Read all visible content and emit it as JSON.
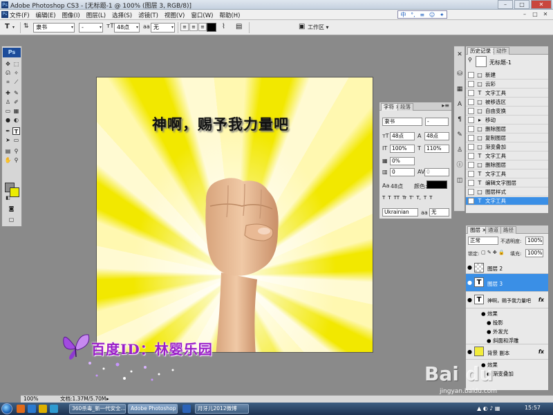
{
  "titlebar": {
    "title": "Adobe Photoshop CS3 - [无标题-1 @ 100% (图层 3, RGB/8)]",
    "minimize": "–",
    "maximize": "□",
    "close": "✕"
  },
  "menubar": {
    "items": [
      "文件(F)",
      "编辑(E)",
      "图像(I)",
      "图层(L)",
      "选择(S)",
      "滤镜(T)",
      "视图(V)",
      "窗口(W)",
      "帮助(H)"
    ],
    "ime": [
      "中",
      "°,",
      "≡",
      "☺",
      "✦"
    ]
  },
  "options": {
    "tool_glyph": "T",
    "font_family": "隶书",
    "font_style": "-",
    "font_size": "48点",
    "antialias": "无",
    "workspace": "工作区",
    "text_color": "#000000"
  },
  "tools": {
    "header": "Ps",
    "icons": [
      "move-tool",
      "marquee-tool",
      "lasso-tool",
      "magic-wand-tool",
      "crop-tool",
      "slice-tool",
      "heal-tool",
      "brush-tool",
      "stamp-tool",
      "history-brush-tool",
      "eraser-tool",
      "gradient-tool",
      "blur-tool",
      "dodge-tool",
      "pen-tool",
      "type-tool",
      "path-select-tool",
      "shape-tool",
      "notes-tool",
      "eyedropper-tool",
      "hand-tool",
      "zoom-tool"
    ],
    "fg_color": "#8d8d8d",
    "bg_color": "#ecec00"
  },
  "canvas": {
    "caption": "神啊，赐予我力量吧"
  },
  "watermark": {
    "text": "百度ID：林婴乐园"
  },
  "char_panel": {
    "tabs": [
      "字符",
      "段落"
    ],
    "font": "隶书",
    "style": "-",
    "size": "48点",
    "leading": "48点",
    "vscale": "100%",
    "hscale": "110%",
    "tracking_pct": "0%",
    "tracking": "0",
    "kerning": "0",
    "baseline": "48点",
    "color_label": "颜色:",
    "language": "Ukrainian",
    "aa": "无",
    "styles": [
      "T",
      "T",
      "TT",
      "Tr",
      "T'",
      "T,",
      "T",
      "T"
    ]
  },
  "history": {
    "tabs": [
      "历史记录",
      "动作"
    ],
    "snapshot": "无标题-1",
    "items": [
      {
        "icon": "□",
        "label": "新建"
      },
      {
        "icon": "□",
        "label": "云彩"
      },
      {
        "icon": "T",
        "label": "文字工具"
      },
      {
        "icon": "□",
        "label": "被移选区"
      },
      {
        "icon": "□",
        "label": "自由变换"
      },
      {
        "icon": "▸",
        "label": "移动"
      },
      {
        "icon": "□",
        "label": "删除图层"
      },
      {
        "icon": "□",
        "label": "复制图层"
      },
      {
        "icon": "□",
        "label": "渐变叠加"
      },
      {
        "icon": "T",
        "label": "文字工具"
      },
      {
        "icon": "□",
        "label": "删除图层"
      },
      {
        "icon": "T",
        "label": "文字工具"
      },
      {
        "icon": "T",
        "label": "编辑文字图层"
      },
      {
        "icon": "□",
        "label": "图层样式"
      },
      {
        "icon": "T",
        "label": "文字工具"
      }
    ]
  },
  "layers": {
    "tabs": [
      "图层",
      "通道",
      "路径"
    ],
    "blend_mode": "正常",
    "opacity_label": "不透明度:",
    "opacity": "100%",
    "lock_label": "锁定:",
    "fill_label": "填充:",
    "fill": "100%",
    "rows": [
      {
        "type": "image",
        "name": "图层 2",
        "fx": ""
      },
      {
        "type": "text",
        "name": "图层 3",
        "fx": ""
      },
      {
        "type": "text",
        "name": "神啊，赐予我力量吧",
        "fx": "fx"
      },
      {
        "type": "effect",
        "name": "效果",
        "fx": ""
      },
      {
        "type": "effect",
        "name": "投影",
        "fx": ""
      },
      {
        "type": "effect",
        "name": "外发光",
        "fx": ""
      },
      {
        "type": "effect",
        "name": "斜面和浮雕",
        "fx": ""
      },
      {
        "type": "image",
        "name": "背景 副本",
        "fx": "fx"
      },
      {
        "type": "effect",
        "name": "效果",
        "fx": ""
      },
      {
        "type": "effect",
        "name": "渐变叠加",
        "fx": ""
      }
    ]
  },
  "status": {
    "zoom": "100%",
    "doc": "文档:1.37M/5.70M"
  },
  "taskbar": {
    "buttons": [
      "360杀毒_新一代安全...",
      "Adobe Photoshop ...",
      "月牙儿2012微博"
    ],
    "clock": "15:57"
  },
  "baidu": {
    "logo": "Bai du",
    "url": "jingyan.baidu.com"
  }
}
